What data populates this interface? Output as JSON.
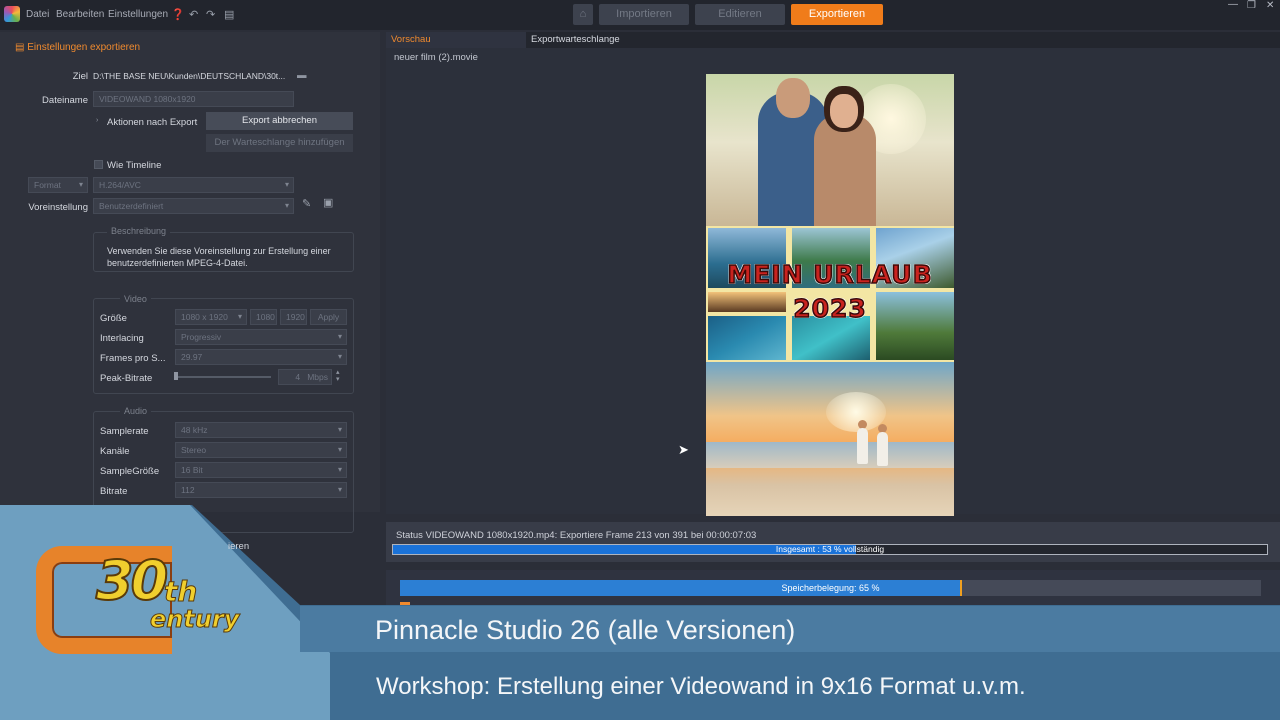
{
  "menu": {
    "file": "Datei",
    "edit": "Bearbeiten",
    "settings": "Einstellungen"
  },
  "nav": {
    "import": "Importieren",
    "edit": "Editieren",
    "export": "Exportieren"
  },
  "left": {
    "header": "Einstellungen exportieren",
    "target_label": "Ziel",
    "target_value": "D:\\THE BASE NEU\\Kunden\\DEUTSCHLAND\\30t...",
    "filename_label": "Dateiname",
    "filename_value": "VIDEOWAND 1080x1920",
    "after_export_label": "Aktionen nach Export",
    "cancel_export": "Export abbrechen",
    "add_queue": "Der Warteschlange hinzufügen",
    "like_timeline": "Wie Timeline",
    "format_select": "Format",
    "codec_select": "H.264/AVC",
    "preset_label": "Voreinstellung",
    "preset_value": "Benutzerdefiniert",
    "description_title": "Beschreibung",
    "description_text": "Verwenden Sie diese Voreinstellung zur Erstellung einer benutzerdefinierten MPEG-4-Datei.",
    "video_group": "Video",
    "size_label": "Größe",
    "size_value": "1080 x 1920",
    "width_value": "1080",
    "height_value": "1920",
    "apply": "Apply",
    "interlacing_label": "Interlacing",
    "interlacing_value": "Progressiv",
    "fps_label": "Frames pro S...",
    "fps_value": "29.97",
    "bitrate_label": "Peak-Bitrate",
    "bitrate_value": "4",
    "bitrate_unit": "Mbps",
    "audio_group": "Audio",
    "samplerate_label": "Samplerate",
    "samplerate_value": "48 kHz",
    "channels_label": "Kanäle",
    "channels_value": "Stereo",
    "samplesize_label": "SampleGröße",
    "samplesize_value": "16 Bit",
    "abitrate_label": "Bitrate",
    "abitrate_value": "112",
    "partial_label": "ieren"
  },
  "tabs": {
    "preview": "Vorschau",
    "queue": "Exportwarteschlange"
  },
  "preview": {
    "filename": "neuer film (2).movie",
    "title_line1": "MEIN URLAUB",
    "title_line2": "2023"
  },
  "status": {
    "text": "Status VIDEOWAND 1080x1920.mp4: Exportiere Frame 213 von 391 bei 00:00:07:03",
    "overall_label": "Insgesamt : 53 % vollständig",
    "overall_percent": 53
  },
  "memory": {
    "label": "Speicherbelegung: 65 %",
    "percent": 65
  },
  "banner": {
    "line1": "Pinnacle Studio 26 (alle Versionen)",
    "line2": "Workshop: Erstellung einer Videowand in 9x16 Format u.v.m."
  },
  "logo": {
    "number": "30",
    "suffix": "th",
    "word": "entury"
  },
  "colors": {
    "accent": "#f07c1a",
    "progress": "#1a72d8",
    "memory": "#2c7fd4"
  }
}
